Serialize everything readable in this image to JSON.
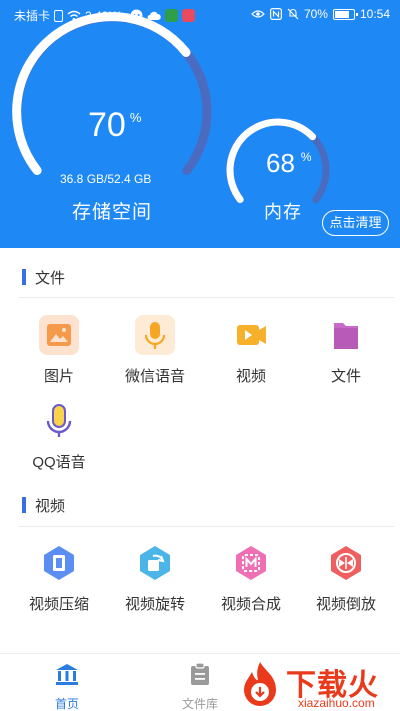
{
  "status_bar": {
    "carrier": "未插卡",
    "speed": "2.49K/s",
    "battery": "70%",
    "time": "10:54"
  },
  "storage": {
    "percent": "70",
    "unit": "%",
    "usage": "36.8 GB/52.4 GB",
    "label": "存储空间",
    "fraction": 0.7
  },
  "memory": {
    "percent": "68",
    "unit": "%",
    "label": "内存",
    "fraction": 0.68
  },
  "clean_button": "点击清理",
  "files_section": {
    "title": "文件",
    "items": [
      {
        "label": "图片",
        "icon": "image-icon"
      },
      {
        "label": "微信语音",
        "icon": "microphone-icon"
      },
      {
        "label": "视频",
        "icon": "video-icon"
      },
      {
        "label": "文件",
        "icon": "folder-icon"
      },
      {
        "label": "QQ语音",
        "icon": "qq-microphone-icon"
      }
    ]
  },
  "video_section": {
    "title": "视频",
    "items": [
      {
        "label": "视频压缩",
        "icon": "compress-icon"
      },
      {
        "label": "视频旋转",
        "icon": "rotate-icon"
      },
      {
        "label": "视频合成",
        "icon": "merge-icon"
      },
      {
        "label": "视频倒放",
        "icon": "reverse-icon"
      }
    ]
  },
  "tabs": [
    {
      "label": "首页",
      "active": true
    },
    {
      "label": "文件库",
      "active": false
    }
  ],
  "watermark": {
    "title": "下载火",
    "url": "xiazaihuo.com"
  },
  "colors": {
    "header": "#1e88f5",
    "accent": "#3a6fe2",
    "brand_watermark": "#e93a1c"
  }
}
